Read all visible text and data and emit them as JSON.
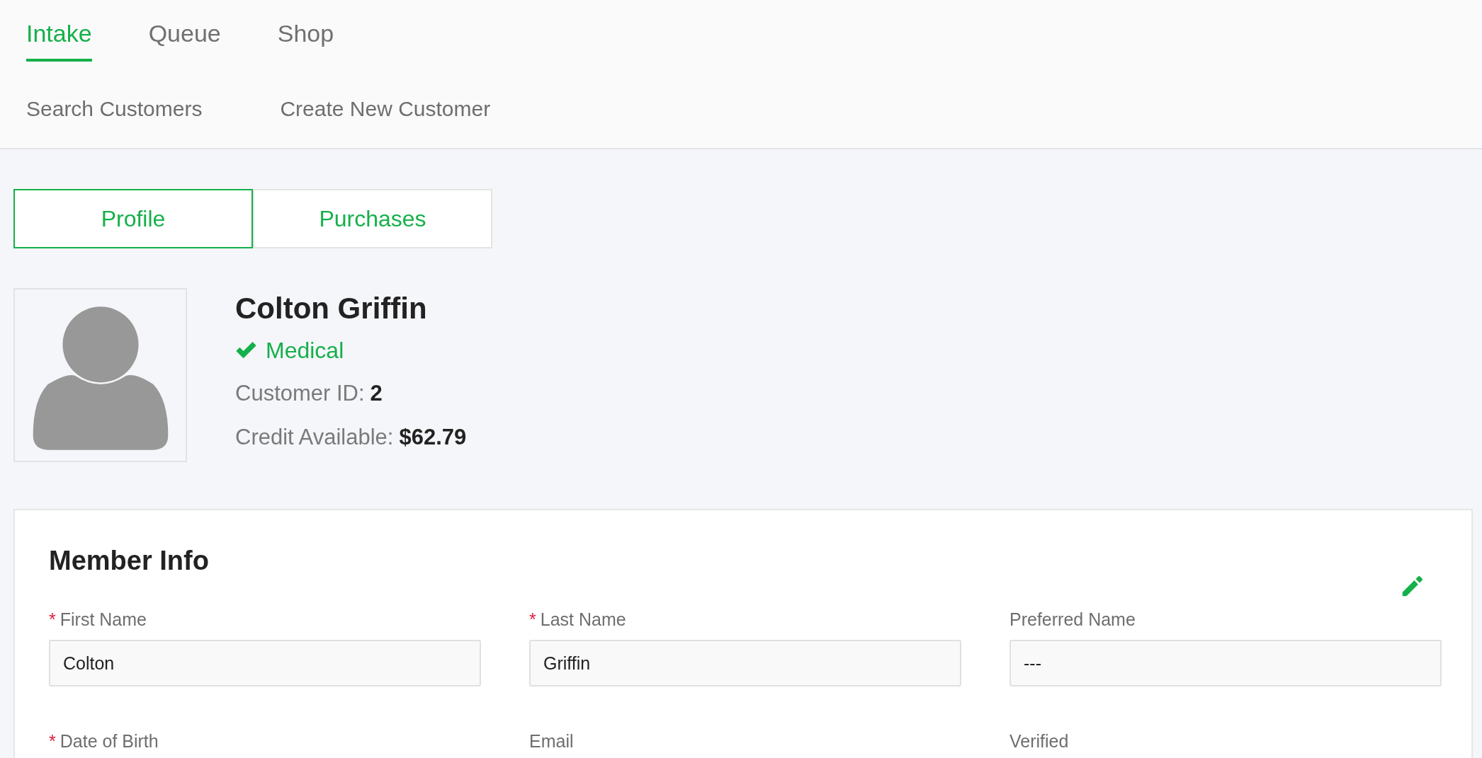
{
  "nav_tabs": [
    {
      "label": "Intake",
      "selected": true
    },
    {
      "label": "Queue",
      "selected": false
    },
    {
      "label": "Shop",
      "selected": false
    }
  ],
  "sub_nav": [
    "Search Customers",
    "Create New Customer"
  ],
  "view_tabs": [
    {
      "label": "Profile",
      "selected": true
    },
    {
      "label": "Purchases",
      "selected": false
    }
  ],
  "customer": {
    "name": "Colton Griffin",
    "status": "Medical",
    "details": [
      {
        "label": "Customer ID:",
        "value": "2"
      },
      {
        "label": "Credit Available:",
        "value": "$62.79"
      }
    ]
  },
  "member_info": {
    "title": "Member Info",
    "required_mark": "*",
    "fields": [
      {
        "label": "First Name",
        "required": true,
        "value": "Colton"
      },
      {
        "label": "Last Name",
        "required": true,
        "value": "Griffin"
      },
      {
        "label": "Preferred Name",
        "required": false,
        "value": "---"
      },
      {
        "label": "Date of Birth",
        "required": true
      },
      {
        "label": "Email",
        "required": false
      },
      {
        "label": "Verified",
        "required": false
      }
    ]
  }
}
